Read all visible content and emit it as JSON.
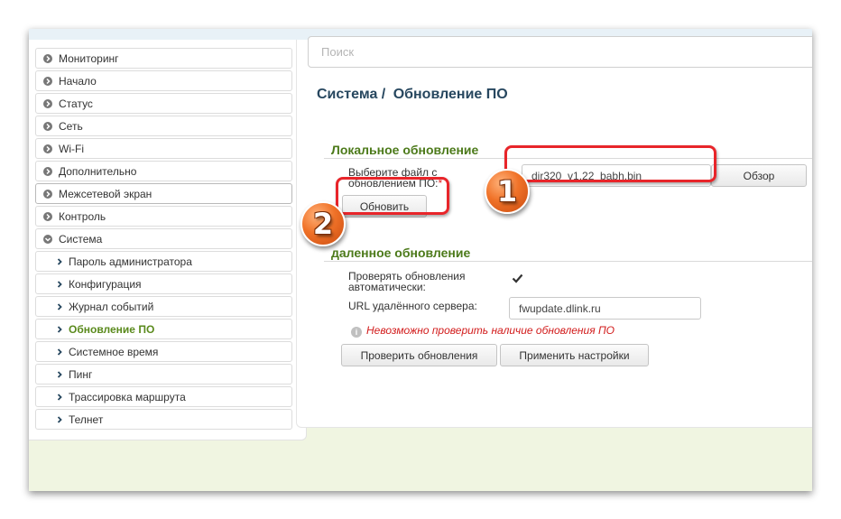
{
  "search": {
    "placeholder": "Поиск"
  },
  "page": {
    "breadcrumb_parent": "Система /",
    "breadcrumb_current": "Обновление ПО"
  },
  "sidebar": {
    "items": [
      {
        "label": "Мониторинг",
        "icon": "chevron-right-circle-icon"
      },
      {
        "label": "Начало",
        "icon": "chevron-right-circle-icon"
      },
      {
        "label": "Статус",
        "icon": "chevron-right-circle-icon"
      },
      {
        "label": "Сеть",
        "icon": "chevron-right-circle-icon"
      },
      {
        "label": "Wi-Fi",
        "icon": "chevron-right-circle-icon"
      },
      {
        "label": "Дополнительно",
        "icon": "chevron-right-circle-icon"
      },
      {
        "label": "Межсетевой экран",
        "icon": "chevron-right-circle-icon"
      },
      {
        "label": "Контроль",
        "icon": "chevron-right-circle-icon"
      },
      {
        "label": "Система",
        "icon": "chevron-down-circle-icon"
      }
    ],
    "subitems": [
      {
        "label": "Пароль администратора"
      },
      {
        "label": "Конфигурация"
      },
      {
        "label": "Журнал событий"
      },
      {
        "label": "Обновление ПО",
        "selected": true
      },
      {
        "label": "Системное время"
      },
      {
        "label": "Пинг"
      },
      {
        "label": "Трассировка маршрута"
      },
      {
        "label": "Телнет"
      }
    ]
  },
  "local_update": {
    "title": "Локальное обновление",
    "file_label": "Выберите файл с обновлением ПО:",
    "required_mark": "*",
    "file_value": "dir320_v1.22_babh.bin",
    "browse_label": "Обзор",
    "update_button": "Обновить"
  },
  "remote_update": {
    "title": "Удаленное обновление",
    "title_visible": "даленное обновление",
    "auto_check_label": "Проверять обновления автоматически:",
    "auto_check_checked": true,
    "url_label": "URL удалённого сервера:",
    "url_value": "fwupdate.dlink.ru",
    "warning": "Невозможно проверить наличие обновления ПО",
    "check_button": "Проверить обновления",
    "apply_button": "Применить настройки"
  },
  "annotations": {
    "badge_1": "1",
    "badge_2": "2",
    "color": "#e8252a",
    "badge_color": "#f07228"
  },
  "colors": {
    "title": "#27475f",
    "section": "#4c7a1a",
    "warning": "#d21c1c",
    "background": "#f0f5e1"
  }
}
